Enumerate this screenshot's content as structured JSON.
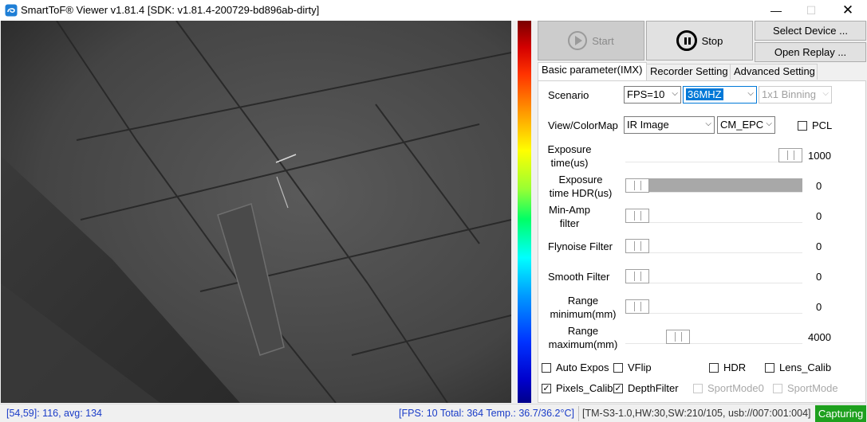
{
  "window": {
    "title": "SmartToF® Viewer v1.81.4 [SDK: v1.81.4-200729-bd896ab-dirty]",
    "minimize": "—",
    "maximize": "☐",
    "close": "✕"
  },
  "toolbar": {
    "start_label": "Start",
    "stop_label": "Stop",
    "select_device_label": "Select Device ...",
    "open_replay_label": "Open Replay ..."
  },
  "tabs": [
    {
      "label": "Basic parameter(IMX)",
      "active": true
    },
    {
      "label": "Recorder Setting",
      "active": false
    },
    {
      "label": "Advanced Setting",
      "active": false
    }
  ],
  "scenario": {
    "label": "Scenario",
    "fps": "FPS=10",
    "freq": "36MHZ",
    "binning": "1x1 Binning"
  },
  "view": {
    "label": "View/ColorMap",
    "mode": "IR Image",
    "colormap": "CM_EPC",
    "pcl_label": "PCL",
    "pcl_checked": false
  },
  "sliders": [
    {
      "label_line1": "Exposure",
      "label_line2": "time(us)",
      "value": "1000",
      "position": 0.9,
      "track": "white"
    },
    {
      "label_line1": "Exposure",
      "label_line2": "time HDR(us)",
      "value": "0",
      "position": 0.0,
      "track": "gray"
    },
    {
      "label_line1": "Min-Amp",
      "label_line2": "filter",
      "value": "0",
      "position": 0.0,
      "track": "white"
    },
    {
      "label_line1": "Flynoise Filter",
      "label_line2": "",
      "value": "0",
      "position": 0.0,
      "track": "white"
    },
    {
      "label_line1": "Smooth Filter",
      "label_line2": "",
      "value": "0",
      "position": 0.0,
      "track": "white"
    },
    {
      "label_line1": "Range",
      "label_line2": "minimum(mm)",
      "value": "0",
      "position": 0.0,
      "track": "white"
    },
    {
      "label_line1": "Range",
      "label_line2": "maximum(mm)",
      "value": "4000",
      "position": 0.25,
      "track": "white"
    }
  ],
  "checkboxes": {
    "auto_expos": {
      "label": "Auto Expos",
      "checked": false
    },
    "vflip": {
      "label": "VFlip",
      "checked": false
    },
    "hdr": {
      "label": "HDR",
      "checked": false
    },
    "lens_calib": {
      "label": "Lens_Calib",
      "checked": false
    },
    "pixels_calib": {
      "label": "Pixels_Calib",
      "checked": true
    },
    "depth_filter": {
      "label": "DepthFilter",
      "checked": true
    },
    "sport_mode0": {
      "label": "SportMode0",
      "checked": false,
      "disabled": true
    },
    "sport_mode": {
      "label": "SportMode",
      "checked": false,
      "disabled": true
    }
  },
  "status": {
    "pixel_info": "[54,59]: 116, avg: 134",
    "fps_info": "[FPS: 10 Total: 364 Temp.: 36.7/36.2°C]",
    "hw_info": "[TM-S3-1.0,HW:30,SW:210/105, usb://007:001:004]",
    "capture_state": "Capturing"
  },
  "colors": {
    "accent": "#0078d7",
    "capture_green": "#1ea01e",
    "status_blue": "#1a3cc8"
  }
}
